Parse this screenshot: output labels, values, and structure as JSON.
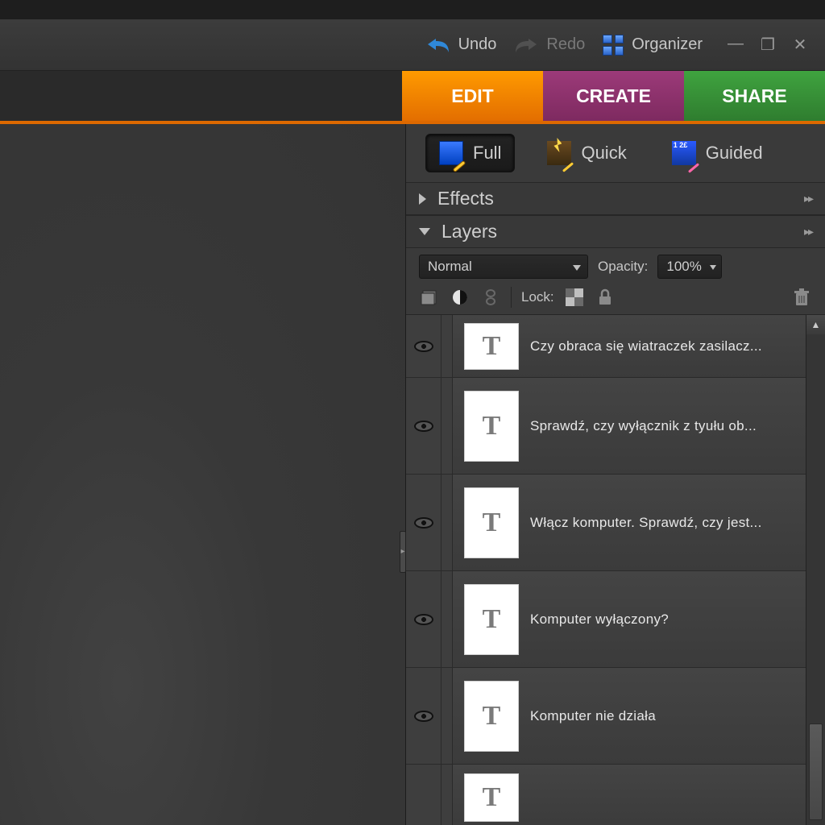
{
  "appbar": {},
  "global": {
    "undo": "Undo",
    "redo": "Redo",
    "organizer": "Organizer"
  },
  "tabs": {
    "edit": "EDIT",
    "create": "CREATE",
    "share": "SHARE"
  },
  "submode": {
    "full": "Full",
    "quick": "Quick",
    "guided": "Guided"
  },
  "sections": {
    "effects": "Effects",
    "layers": "Layers"
  },
  "layers_panel": {
    "blend_mode": "Normal",
    "opacity_label": "Opacity:",
    "opacity_value": "100%",
    "lock_label": "Lock:"
  },
  "layers": [
    {
      "name": "Czy obraca się wiatraczek zasilacz..."
    },
    {
      "name": "Sprawdź, czy wyłącznik z tyułu ob..."
    },
    {
      "name": "Włącz komputer. Sprawdź, czy jest..."
    },
    {
      "name": "Komputer wyłączony?"
    },
    {
      "name": "Komputer nie działa"
    },
    {
      "name": ""
    }
  ]
}
